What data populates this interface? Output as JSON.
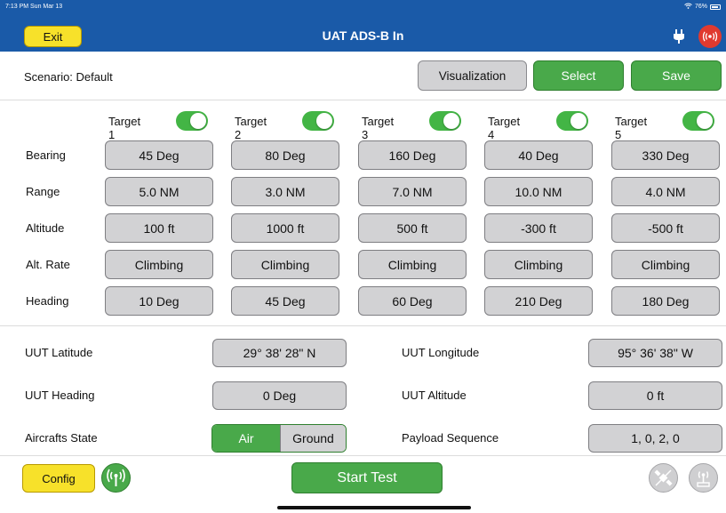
{
  "status_bar": {
    "time": "7:13 PM  Sun Mar 13",
    "battery": "76%"
  },
  "header": {
    "exit_label": "Exit",
    "title": "UAT ADS-B In"
  },
  "scenario": {
    "label": "Scenario: Default",
    "visualization_label": "Visualization",
    "select_label": "Select",
    "save_label": "Save"
  },
  "targets": [
    {
      "name": "Target 1",
      "enabled": true
    },
    {
      "name": "Target 2",
      "enabled": true
    },
    {
      "name": "Target 3",
      "enabled": true
    },
    {
      "name": "Target 4",
      "enabled": true
    },
    {
      "name": "Target 5",
      "enabled": true
    }
  ],
  "rows": [
    {
      "label": "Bearing",
      "values": [
        "45 Deg",
        "80 Deg",
        "160 Deg",
        "40 Deg",
        "330 Deg"
      ]
    },
    {
      "label": "Range",
      "values": [
        "5.0 NM",
        "3.0 NM",
        "7.0 NM",
        "10.0 NM",
        "4.0 NM"
      ]
    },
    {
      "label": "Altitude",
      "values": [
        "100 ft",
        "1000 ft",
        "500 ft",
        "-300 ft",
        "-500 ft"
      ]
    },
    {
      "label": "Alt. Rate",
      "values": [
        "Climbing",
        "Climbing",
        "Climbing",
        "Climbing",
        "Climbing"
      ]
    },
    {
      "label": "Heading",
      "values": [
        "10 Deg",
        "45 Deg",
        "60 Deg",
        "210 Deg",
        "180 Deg"
      ]
    }
  ],
  "uut": {
    "latitude_label": "UUT Latitude",
    "latitude_value": "29° 38' 28\" N",
    "longitude_label": "UUT Longitude",
    "longitude_value": "95° 36' 38\" W",
    "heading_label": "UUT Heading",
    "heading_value": "0 Deg",
    "altitude_label": "UUT Altitude",
    "altitude_value": "0 ft",
    "state_label": "Aircrafts State",
    "state_air": "Air",
    "state_ground": "Ground",
    "state_selected": "Air",
    "payload_label": "Payload Sequence",
    "payload_value": "1, 0, 2, 0"
  },
  "footer": {
    "config_label": "Config",
    "start_label": "Start Test"
  },
  "colors": {
    "header_blue": "#1a5aa8",
    "green": "#49a94a",
    "yellow": "#f7e12a",
    "red": "#e03a2f",
    "button_gray": "#d2d2d4"
  },
  "icons": [
    "plug-icon",
    "broadcast-icon",
    "antenna-icon",
    "satellite-off-icon",
    "receiver-icon"
  ]
}
